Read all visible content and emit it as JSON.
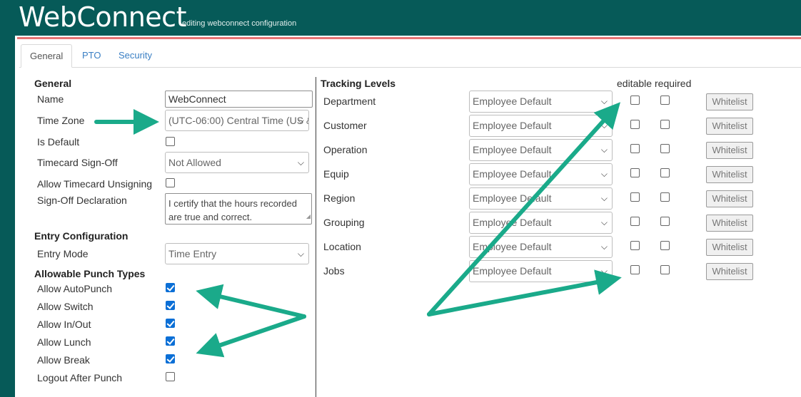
{
  "header": {
    "title": "WebConnect",
    "subtitle": "editing webconnect configuration"
  },
  "tabs": [
    {
      "label": "General",
      "active": true
    },
    {
      "label": "PTO",
      "active": false
    },
    {
      "label": "Security",
      "active": false
    }
  ],
  "general": {
    "heading": "General",
    "name_label": "Name",
    "name_value": "WebConnect",
    "timezone_label": "Time Zone",
    "timezone_value": "(UTC-06:00) Central Time (US &",
    "is_default_label": "Is Default",
    "is_default_checked": false,
    "signoff_label": "Timecard Sign-Off",
    "signoff_value": "Not Allowed",
    "unsign_label": "Allow Timecard Unsigning",
    "unsign_checked": false,
    "declaration_label": "Sign-Off Declaration",
    "declaration_value": "I certify that the hours recorded are true and correct."
  },
  "entry": {
    "heading": "Entry Configuration",
    "mode_label": "Entry Mode",
    "mode_value": "Time Entry"
  },
  "punch": {
    "heading": "Allowable Punch Types",
    "items": [
      {
        "label": "Allow AutoPunch",
        "checked": true
      },
      {
        "label": "Allow Switch",
        "checked": true
      },
      {
        "label": "Allow In/Out",
        "checked": true
      },
      {
        "label": "Allow Lunch",
        "checked": true
      },
      {
        "label": "Allow Break",
        "checked": true
      },
      {
        "label": "Logout After Punch",
        "checked": false
      }
    ]
  },
  "tracking": {
    "heading": "Tracking Levels",
    "col_editable": "editable",
    "col_required": "required",
    "whitelist_label": "Whitelist",
    "rows": [
      {
        "label": "Department",
        "value": "Employee Default",
        "editable": false,
        "required": false
      },
      {
        "label": "Customer",
        "value": "Employee Default",
        "editable": false,
        "required": false
      },
      {
        "label": "Operation",
        "value": "Employee Default",
        "editable": false,
        "required": false
      },
      {
        "label": "Equip",
        "value": "Employee Default",
        "editable": false,
        "required": false
      },
      {
        "label": "Region",
        "value": "Employee Default",
        "editable": false,
        "required": false
      },
      {
        "label": "Grouping",
        "value": "Employee Default",
        "editable": false,
        "required": false
      },
      {
        "label": "Location",
        "value": "Employee Default",
        "editable": false,
        "required": false
      },
      {
        "label": "Jobs",
        "value": "Employee Default",
        "editable": false,
        "required": false
      }
    ]
  },
  "colors": {
    "header_bg": "#065a58",
    "accent_line": "#e57373",
    "annotation_arrow": "#1aaa8a",
    "checkbox_checked": "#0b6fd6"
  }
}
